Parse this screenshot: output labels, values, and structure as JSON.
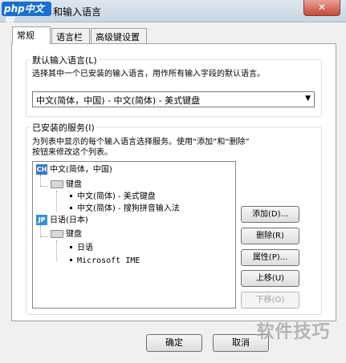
{
  "title": {
    "logo": "php中文网",
    "text": "和输入语言",
    "close": "✕"
  },
  "tabs": [
    {
      "label": "常规"
    },
    {
      "label": "语言栏"
    },
    {
      "label": "高级键设置"
    }
  ],
  "default_group": {
    "title": "默认输入语言(L)",
    "description": "选择其中一个已安装的输入语言，用作所有输入字段的默认语言。",
    "selected": "中文(简体，中国) - 中文(简体) - 美式键盘",
    "arrow": "▼"
  },
  "installed_group": {
    "title": "已安装的服务(I)",
    "description_line1": "为列表中显示的每个输入语言选择服务。使用“添加”和“删除”",
    "description_line2": "按钮来修改这个列表。"
  },
  "tree": {
    "lang1": {
      "badge": "CH",
      "label": "中文(简体，中国)",
      "group": "键盘",
      "items": [
        "中文(简体) - 美式键盘",
        "中文(简体) - 搜狗拼音输入法"
      ]
    },
    "lang2": {
      "badge": "JP",
      "label": "日语(日本)",
      "group": "键盘",
      "items": [
        "日语",
        "Microsoft IME"
      ]
    }
  },
  "side_buttons": {
    "add": "添加(D)...",
    "remove": "删除(R)",
    "properties": "属性(P)...",
    "move_up": "上移(U)",
    "move_down": "下移(O)"
  },
  "bottom_buttons": {
    "ok": "确定",
    "cancel": "取消"
  },
  "watermark": "软件技巧",
  "colors": {
    "ch_badge": "#3a78c8",
    "jp_badge": "#3a8fd0"
  }
}
